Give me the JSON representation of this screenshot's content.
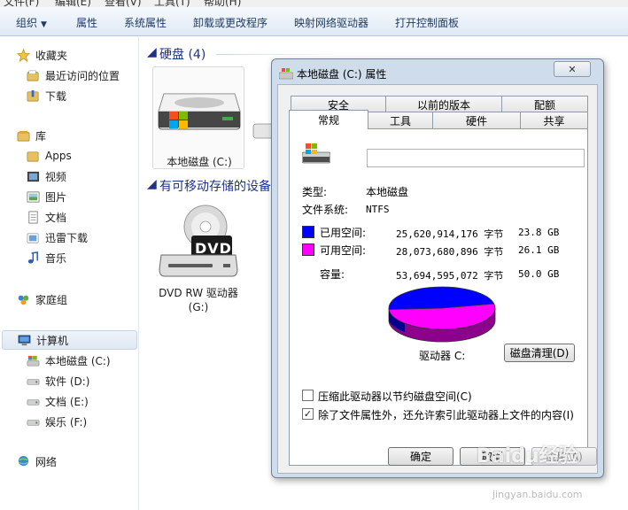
{
  "menubar": {
    "items": [
      "文件(F)",
      "编辑(E)",
      "查看(V)",
      "工具(T)",
      "帮助(H)"
    ]
  },
  "cmdbar": {
    "organize": "组织",
    "properties": "属性",
    "system_properties": "系统属性",
    "uninstall": "卸载或更改程序",
    "map_drive": "映射网络驱动器",
    "control_panel": "打开控制面板"
  },
  "nav": {
    "favorites": "收藏夹",
    "recent": "最近访问的位置",
    "downloads": "下载",
    "libraries": "库",
    "apps": "Apps",
    "videos": "视频",
    "pictures": "图片",
    "documents": "文档",
    "xunlei": "迅雷下载",
    "music": "音乐",
    "homegroup": "家庭组",
    "computer": "计算机",
    "drive_c": "本地磁盘 (C:)",
    "drive_d": "软件 (D:)",
    "drive_e": "文档 (E:)",
    "drive_f": "娱乐 (F:)",
    "network": "网络"
  },
  "content": {
    "hdd_group": "硬盘 (4)",
    "removable_group": "有可移动存储的设备",
    "drive_c_label": "本地磁盘 (C:)",
    "dvd_label_1": "DVD RW 驱动器",
    "dvd_label_2": "(G:)",
    "dvd_icon_text": "DVD"
  },
  "dialog": {
    "title": "本地磁盘 (C:) 属性",
    "close": "✕",
    "tabs_back": [
      "安全",
      "以前的版本",
      "配额"
    ],
    "tabs_front": [
      "常规",
      "工具",
      "硬件",
      "共享"
    ],
    "name_value": "",
    "type_label": "类型:",
    "type_value": "本地磁盘",
    "fs_label": "文件系统:",
    "fs_value": "NTFS",
    "used_label": "已用空间:",
    "used_bytes": "25,620,914,176 字节",
    "used_gb": "23.8 GB",
    "free_label": "可用空间:",
    "free_bytes": "28,073,680,896 字节",
    "free_gb": "26.1 GB",
    "cap_label": "容量:",
    "cap_bytes": "53,694,595,072 字节",
    "cap_gb": "50.0 GB",
    "drive_label": "驱动器 C:",
    "cleanup": "磁盘清理(D)",
    "compress": "压缩此驱动器以节约磁盘空间(C)",
    "compress_checked": false,
    "index": "除了文件属性外，还允许索引此驱动器上文件的内容(I)",
    "index_checked": true,
    "ok": "确定",
    "cancel": "取消",
    "apply": "应用(A)",
    "used_color": "#0000ff",
    "free_color": "#ff00ff",
    "used_fraction": 0.477
  },
  "watermark": {
    "brand": "Baidu经验",
    "url": "jingyan.baidu.com"
  }
}
